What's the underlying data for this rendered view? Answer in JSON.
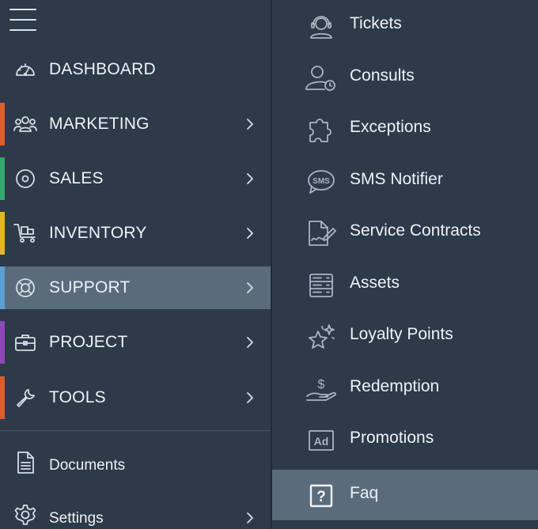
{
  "sidebar": {
    "menu_icon": "hamburger-icon",
    "items": [
      {
        "label": "DASHBOARD",
        "icon": "dashboard-gauge-icon",
        "accent": "",
        "has_submenu": false
      },
      {
        "label": "MARKETING",
        "icon": "users-group-icon",
        "accent": "#e15b2a",
        "has_submenu": true
      },
      {
        "label": "SALES",
        "icon": "target-icon",
        "accent": "#35a66a",
        "has_submenu": true
      },
      {
        "label": "INVENTORY",
        "icon": "cart-icon",
        "accent": "#e2b722",
        "has_submenu": true
      },
      {
        "label": "SUPPORT",
        "icon": "lifebuoy-icon",
        "accent": "#5b9fd6",
        "has_submenu": true,
        "active": true
      },
      {
        "label": "PROJECT",
        "icon": "briefcase-icon",
        "accent": "#8e47b7",
        "has_submenu": true
      },
      {
        "label": "TOOLS",
        "icon": "wrench-icon",
        "accent": "#e15b2a",
        "has_submenu": true
      }
    ],
    "bottom_items": [
      {
        "label": "Documents",
        "icon": "document-icon"
      },
      {
        "label": "Settings",
        "icon": "gear-icon",
        "has_submenu": true
      }
    ]
  },
  "submenu": {
    "items": [
      {
        "label": "Tickets",
        "icon": "headset-icon"
      },
      {
        "label": "Consults",
        "icon": "user-clock-icon"
      },
      {
        "label": "Exceptions",
        "icon": "puzzle-icon"
      },
      {
        "label": "SMS Notifier",
        "icon": "sms-bubble-icon",
        "icon_text": "SMS"
      },
      {
        "label": "Service Contracts",
        "icon": "contract-sign-icon"
      },
      {
        "label": "Assets",
        "icon": "server-icon"
      },
      {
        "label": "Loyalty Points",
        "icon": "star-sparkle-icon"
      },
      {
        "label": "Redemption",
        "icon": "hand-dollar-icon",
        "icon_text": "$"
      },
      {
        "label": "Promotions",
        "icon": "ad-icon",
        "icon_text": "Ad"
      },
      {
        "label": "Faq",
        "icon": "question-box-icon",
        "icon_text": "?",
        "active": true
      }
    ]
  },
  "colors": {
    "background": "#2c3a4a",
    "active_row": "#5a6c7c",
    "text": "#eef2f5"
  }
}
